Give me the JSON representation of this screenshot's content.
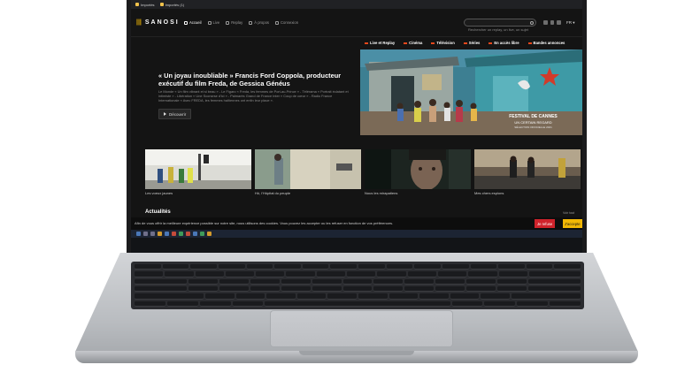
{
  "browser": {
    "bookmarks": [
      {
        "label": "Importés",
        "icon": "folder-icon"
      },
      {
        "label": "Importés (1)",
        "icon": "folder-icon"
      }
    ]
  },
  "header": {
    "logo_text": "SANOSI",
    "logo_bars": "|||",
    "nav": [
      {
        "label": "Accueil",
        "icon": "home-icon",
        "active": true
      },
      {
        "label": "Live",
        "icon": "live-icon",
        "active": false
      },
      {
        "label": "Replay",
        "icon": "replay-icon",
        "active": false
      },
      {
        "label": "À propos",
        "icon": "info-icon",
        "active": false
      },
      {
        "label": "Connexion",
        "icon": "user-icon",
        "active": false
      }
    ],
    "search_placeholder": "Rechercher un replay, un live, un sujet",
    "lang": "FR ▾"
  },
  "categories": [
    {
      "label": "Live et Replay"
    },
    {
      "label": "Cinéma"
    },
    {
      "label": "Télévision"
    },
    {
      "label": "Séries"
    },
    {
      "label": "En accès libre"
    },
    {
      "label": "Bandes annonces"
    }
  ],
  "hero": {
    "title": "« Un joyau inoubliable » Francis Ford Coppola, producteur exécutif du film Freda, de Gessica Généus",
    "description": "Le Monde « Un film vibrant et si beau » - Le Figaro « Freda, les femmes de Port-au-Prince » - Télérama « Portrait éclatant et intimiste » - Libération « Une Scorsese d'ici » - Palmarès Grand de France Inter « Coup de cœur » - Radio France Internationale « Avec FREDA, les femmes haïtiennes ont enfin leur place ».",
    "button_label": "Découvrir",
    "festival": {
      "line1": "FESTIVAL DE CANNES",
      "line2": "UN CERTAIN REGARD",
      "line3": "SÉLECTION OFFICIELLE 2021"
    }
  },
  "thumbs": [
    {
      "caption": "Les voeux jaunes"
    },
    {
      "caption": "Hô, l'Hôpital du peuple"
    },
    {
      "caption": "Nous les mirapatiens"
    },
    {
      "caption": "Mes chers espions"
    }
  ],
  "section": {
    "title": "Actualités",
    "top_link": "Voir tout"
  },
  "cookie": {
    "text": "Afin de vous offrir la meilleure expérience possible sur notre site, nous utilisons des cookies. Vous pouvez les accepter ou les refuser en fonction de vos préférences.",
    "refuse_label": "Je refuse",
    "accept_label": "J'accepte"
  },
  "colors": {
    "accent_yellow": "#f2b705",
    "accent_red": "#d0232b",
    "category_marker": "#e8481c",
    "site_bg": "#141414"
  }
}
